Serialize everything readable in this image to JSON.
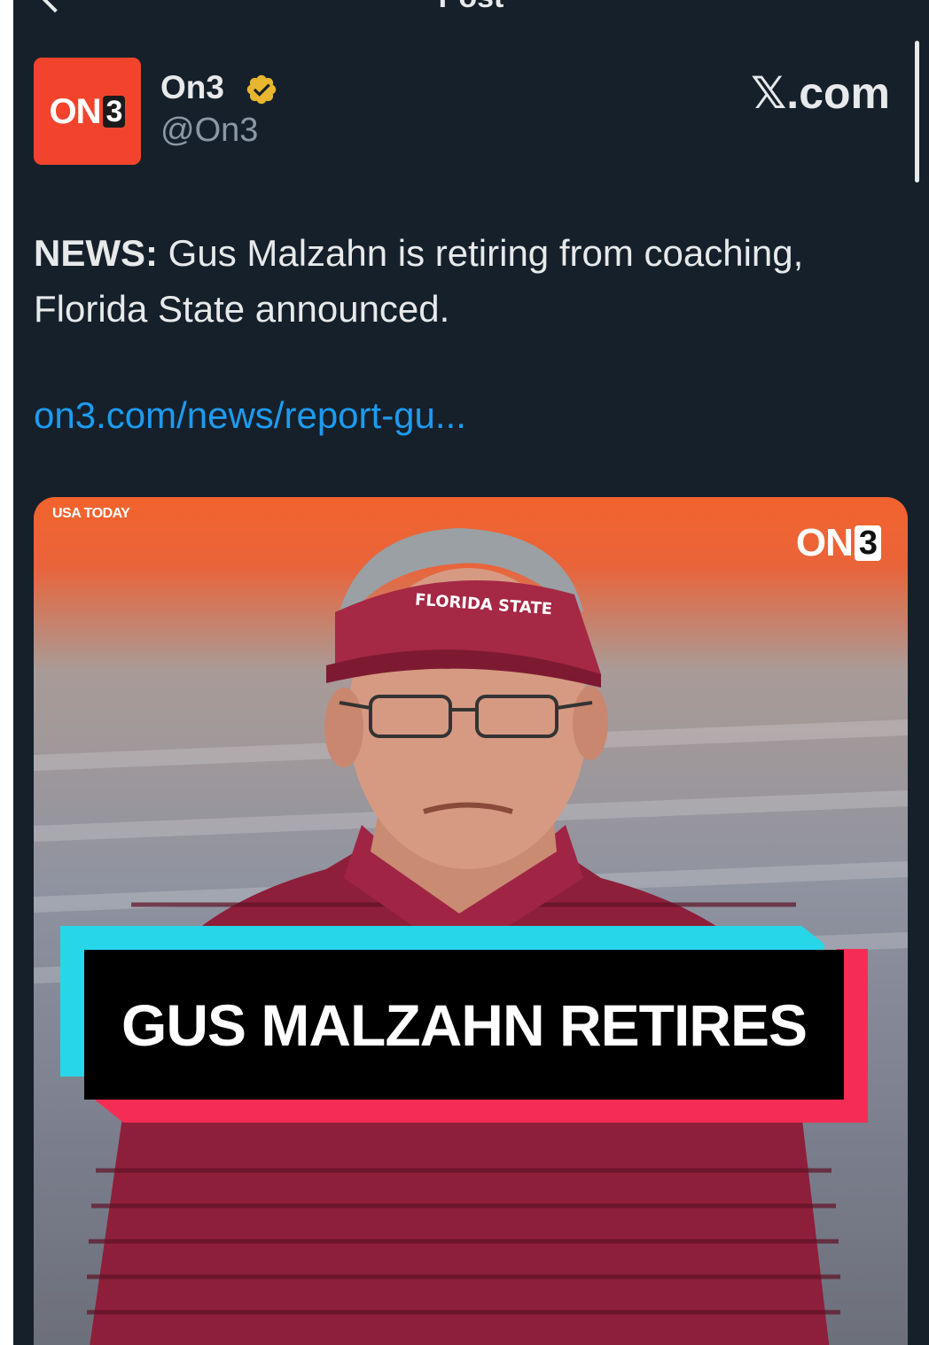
{
  "header": {
    "title": "Post"
  },
  "author": {
    "avatar_logo": {
      "text": "ON",
      "box": "3"
    },
    "display_name": "On3",
    "handle": "@On3",
    "verified": true
  },
  "source_label": "𝕏.com",
  "post": {
    "lead": "NEWS:",
    "body": " Gus Malzahn is retiring from coaching, Florida State announced.",
    "link": "on3.com/news/report-gu..."
  },
  "media": {
    "credit": "USA TODAY",
    "watermark": {
      "text": "ON",
      "box": "3"
    },
    "visor_text": "FLORIDA STATE",
    "banner_text": "GUS MALZAHN RETIRES"
  },
  "colors": {
    "background": "#15202b",
    "text": "#e7e9ea",
    "muted": "#8b98a5",
    "link": "#1d9bf0",
    "on3_brand": "#f2442d",
    "verified_gold": "#e8b62f",
    "banner_cyan": "#27d6e8",
    "banner_pink": "#f52d54"
  }
}
